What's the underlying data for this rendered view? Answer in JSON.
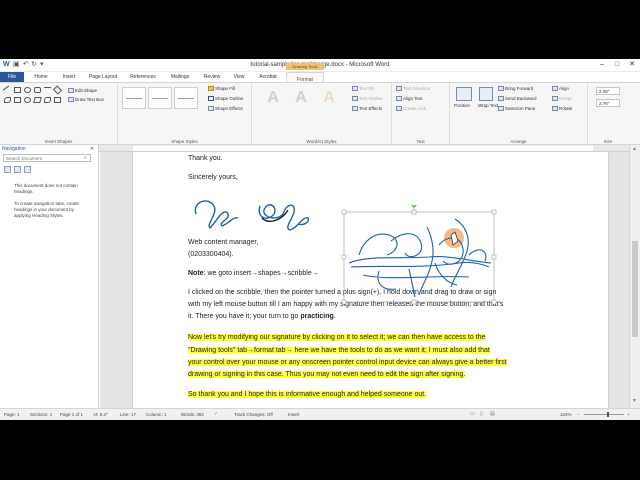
{
  "window": {
    "title": "tutorial-sampledoc-mailmerge.docx - Microsoft Word",
    "minimize_glyph": "–",
    "maximize_glyph": "□",
    "close_glyph": "✕"
  },
  "tabs": {
    "file": "File",
    "home": "Home",
    "insert": "Insert",
    "page_layout": "Page Layout",
    "references": "References",
    "mailings": "Mailings",
    "review": "Review",
    "view": "View",
    "acrobat": "Acrobat",
    "contextual_group": "Drawing Tools",
    "format": "Format"
  },
  "ribbon": {
    "insert_shapes": {
      "label": "Insert Shapes",
      "edit_shape": "Edit Shape",
      "draw_text_box": "Draw Text Box"
    },
    "shape_styles": {
      "label": "Shape Styles",
      "shape_fill": "Shape Fill",
      "shape_outline": "Shape Outline",
      "shape_effects": "Shape Effects"
    },
    "wordart_styles": {
      "label": "WordArt Styles",
      "letter": "A",
      "text_fill": "Text Fill",
      "text_outline": "Text Outline",
      "text_effects": "Text Effects"
    },
    "text": {
      "label": "Text",
      "text_direction": "Text Direction",
      "align_text": "Align Text",
      "create_link": "Create Link"
    },
    "arrange": {
      "label": "Arrange",
      "position": "Position",
      "wrap_text": "Wrap Text",
      "bring_forward": "Bring Forward",
      "send_backward": "Send Backward",
      "selection_pane": "Selection Pane",
      "align": "Align",
      "group": "Group",
      "rotate": "Rotate"
    },
    "size": {
      "label": "Size",
      "height": "2.08\"",
      "width": "2.76\""
    }
  },
  "navigation": {
    "title": "Navigation",
    "search_placeholder": "Search Document",
    "message1": "This document does not contain headings.",
    "message2": "To create navigation tabs, create headings in your document by applying Heading Styles."
  },
  "document": {
    "thank_you": "Thank you.",
    "sincerely": "Sincerely yours,",
    "role": "Web content manager,",
    "phone": "(0203300404).",
    "note_label": "Note",
    "note_text": ": we goto insert→shapes→scribble→",
    "para1_line1": " I clicked on the scribble, then the pointer turned a plus sign(+), I hold down and drag to draw or sign",
    "para1_line2": "with my left mouse button till I am happy with my signature then released the mouse button; and that's",
    "para1_line3_a": "it. There you have it; your turn to go ",
    "para1_line3_b": "practicing",
    "para1_line3_c": ".",
    "para2_line1": "Now let's try modifying our signature by clicking on it to select it; we can then have access to the",
    "para2_line2": "\"Drawing tools\" tab→format tab→ here we have the tools to do as we want it;  I must also add that",
    "para2_line3": "your control over your mouse or any onscreen pointer control input device  can always give a better first",
    "para2_line4": "drawing or signing in this case. Thus you may not even need to edit the sign after signing.",
    "para3": "So thank you and I hope this is informative enough and helped someone out."
  },
  "status": {
    "page": "Page: 1",
    "sections": "Sections: 1",
    "page_of": "Page 1 of 1",
    "at": "At: 5.4\"",
    "line": "Line: 17",
    "column": "Column: 1",
    "words": "Words: 382",
    "track_changes": "Track Changes: Off",
    "insert": "Insert",
    "zoom": "124%"
  },
  "colors": {
    "accent": "#2b579a",
    "contextual_tab": "#e8c17a",
    "highlight": "#ffff3a",
    "ink": "#1f5fb0"
  }
}
